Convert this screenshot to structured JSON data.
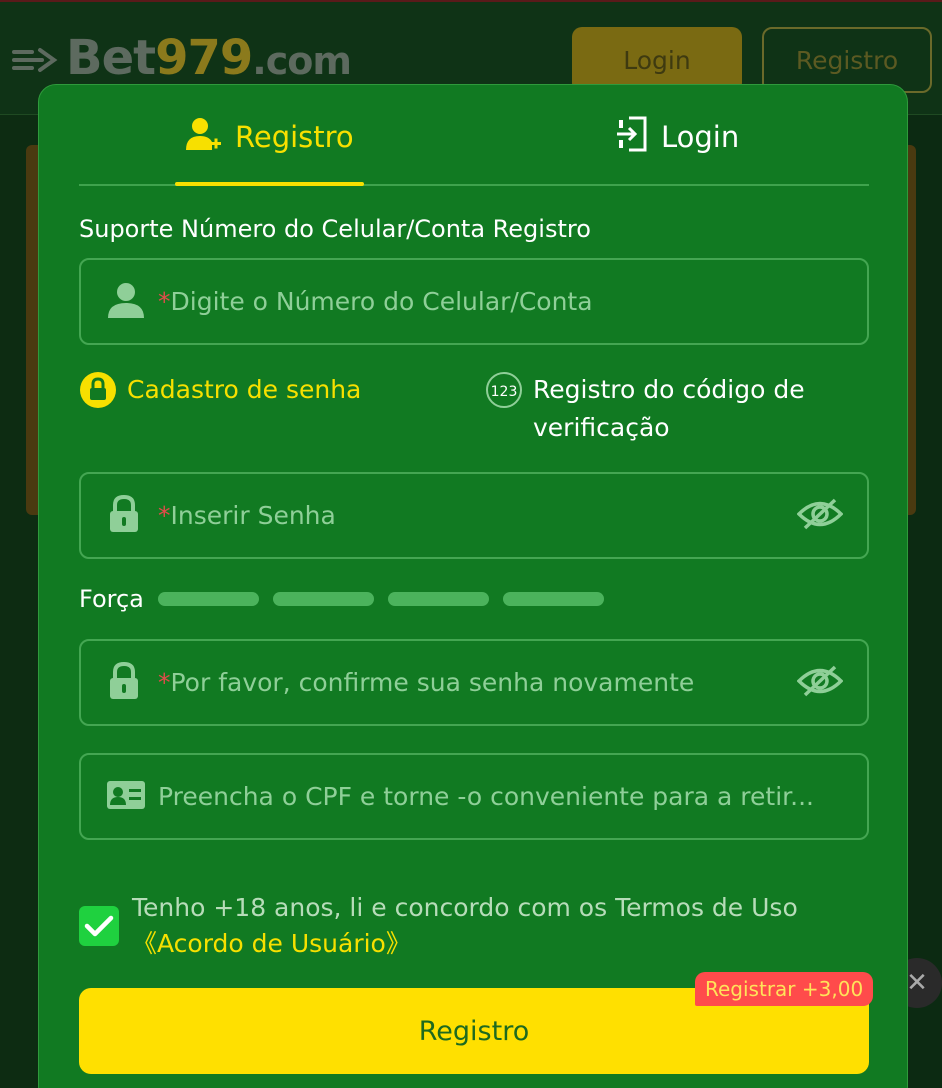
{
  "background": {
    "logo_prefix": "Bet",
    "logo_number": "979",
    "logo_suffix": ".com",
    "login_button": "Login",
    "register_button": "Registro"
  },
  "modal": {
    "tabs": [
      {
        "label": "Registro",
        "icon": "add-user-icon",
        "active": true
      },
      {
        "label": "Login",
        "icon": "login-door-icon",
        "active": false
      }
    ],
    "section_label": "Suporte Número do Celular/Conta Registro",
    "account_field": {
      "required_mark": "*",
      "placeholder": "Digite o Número do Celular/Conta",
      "icon": "user-icon"
    },
    "options": {
      "password": {
        "label": "Cadastro de senha",
        "icon": "lock-circle-icon",
        "selected": true
      },
      "code": {
        "label": "Registro do código de verificação",
        "icon": "123-icon",
        "badge": "123",
        "selected": false
      }
    },
    "password_field": {
      "required_mark": "*",
      "placeholder": "Inserir Senha",
      "icon": "lock-icon"
    },
    "strength": {
      "label": "Força",
      "segments": 4
    },
    "confirm_field": {
      "required_mark": "*",
      "placeholder": "Por favor, confirme sua senha novamente",
      "icon": "lock-icon"
    },
    "cpf_field": {
      "placeholder": "Preencha o CPF e torne -o conveniente para a retir...",
      "icon": "id-card-icon"
    },
    "agreement": {
      "checked": true,
      "text": "Tenho +18 anos, li e concordo com os Termos de Uso",
      "link": "《Acordo de Usuário》"
    },
    "submit_label": "Registro",
    "bonus_badge": "Registrar +3,00"
  },
  "colors": {
    "modal_bg": "#117a22",
    "accent_yellow": "#f7e000",
    "field_border": "#44a652",
    "placeholder": "#8fcf98",
    "required": "#e24b4b",
    "bonus_bg": "#ff4b4b"
  }
}
